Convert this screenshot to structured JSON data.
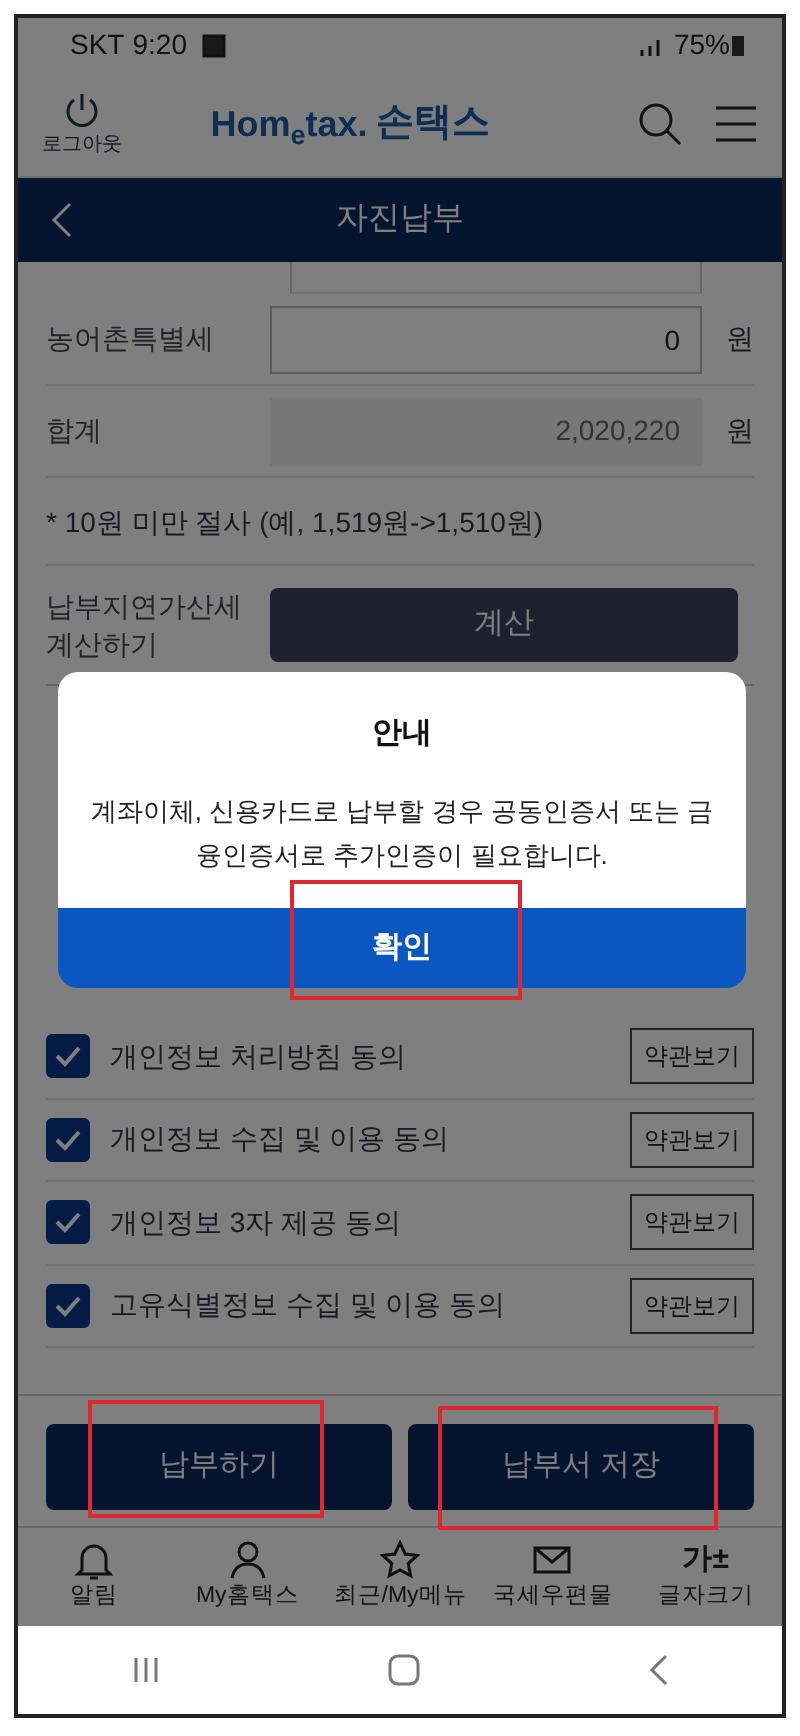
{
  "status_bar": {
    "carrier": "SKT",
    "time": "9:20",
    "battery": "75%"
  },
  "header": {
    "logout_label": "로그아웃",
    "logo_text": "Hom$_{e}$tax.",
    "logo_korean": "손택스"
  },
  "title_bar": {
    "title": "자진납부"
  },
  "fields": [
    {
      "label": "농어촌특별세",
      "value": "0",
      "unit": "원",
      "readonly": false
    },
    {
      "label": "합계",
      "value": "2,020,220",
      "unit": "원",
      "readonly": true
    }
  ],
  "note": "* 10원 미만 절사 (예, 1,519원->1,510원)",
  "late_fee": {
    "label": "납부지연가산세 계산하기",
    "button": "계산"
  },
  "agreements": [
    {
      "label": "개인정보 처리방침 동의",
      "checked": true,
      "button": "약관보기"
    },
    {
      "label": "개인정보 수집 및 이용 동의",
      "checked": true,
      "button": "약관보기"
    },
    {
      "label": "개인정보 3자 제공 동의",
      "checked": true,
      "button": "약관보기"
    },
    {
      "label": "고유식별정보 수집 및 이용 동의",
      "checked": true,
      "button": "약관보기"
    }
  ],
  "actions": [
    {
      "label": "납부하기",
      "highlighted": true
    },
    {
      "label": "납부서 저장",
      "highlighted": true
    }
  ],
  "bottom_nav": [
    {
      "kind": "bell",
      "label": "알림"
    },
    {
      "kind": "person",
      "label": "My홈택스"
    },
    {
      "kind": "star",
      "label": "최근/My메뉴"
    },
    {
      "kind": "mail",
      "label": "국세우편물"
    },
    {
      "kind": "glyph",
      "glyph": "가±",
      "label": "글자크기"
    }
  ],
  "dialog": {
    "title": "안내",
    "message": "계좌이체, 신용카드로 납부할 경우 공동인증서 또는 금융인증서로 추가인증이 필요합니다.",
    "confirm": {
      "label": "확인",
      "highlighted": true
    }
  }
}
